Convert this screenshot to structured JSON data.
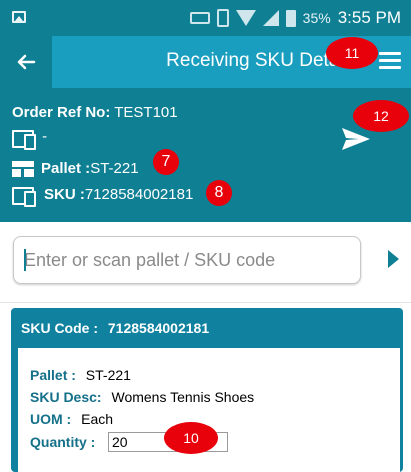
{
  "status_bar": {
    "battery_percent": "35%",
    "time": "3:55 PM",
    "icons": [
      "image-icon",
      "keyboard-icon",
      "vibrate-icon",
      "wifi-icon",
      "signal-icon",
      "battery-icon"
    ]
  },
  "header": {
    "title": "Receiving SKU Detail",
    "back_icon": "arrow-left-icon",
    "menu_icon": "menu-icon"
  },
  "info": {
    "order_ref_label": "Order Ref No:",
    "order_ref_value": "TEST101",
    "device_value": "-",
    "pallet_label": "Pallet :",
    "pallet_value": "ST-221",
    "sku_label": "SKU :",
    "sku_value": "7128584002181",
    "send_icon": "send-icon"
  },
  "scan": {
    "placeholder": "Enter or scan pallet / SKU code",
    "go_icon": "play-arrow-icon"
  },
  "card": {
    "header_label": "SKU Code :",
    "header_value": "7128584002181",
    "pallet_label": "Pallet :",
    "pallet_value": "ST-221",
    "desc_label": "SKU Desc:",
    "desc_value": "Womens Tennis Shoes",
    "uom_label": "UOM :",
    "uom_value": "Each",
    "quantity_label": "Quantity :",
    "quantity_value": "20"
  },
  "annotations": {
    "badge_7": "7",
    "badge_8": "8",
    "badge_10": "10",
    "badge_11": "11",
    "badge_12": "12"
  },
  "colors": {
    "primary": "#0f7f94",
    "header_panel": "#1a9ec0",
    "card": "#1082a0",
    "badge": "#e8000b"
  }
}
